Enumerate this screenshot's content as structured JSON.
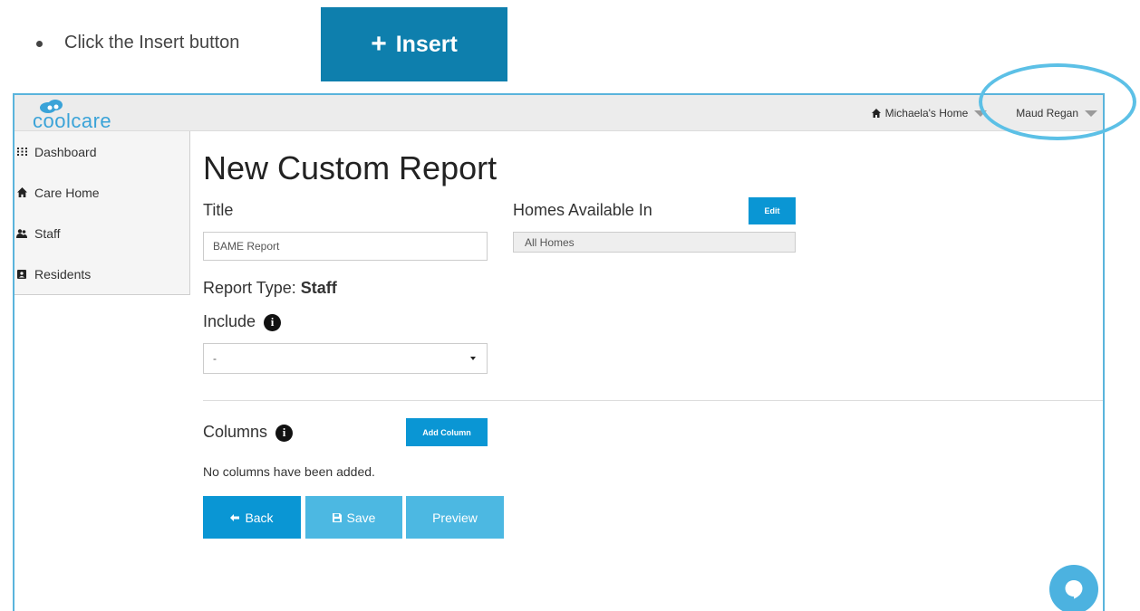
{
  "instruction": {
    "text": "Click the Insert button",
    "sample_button": {
      "icon": "plus-icon",
      "label": "Insert",
      "color": "#0e7fad"
    }
  },
  "app": {
    "logo_text": "coolcare",
    "header": {
      "home_icon": "home-icon",
      "home_label": "Michaela's Home",
      "user_label": "Maud Regan"
    },
    "sidebar": {
      "items": [
        {
          "icon": "grid-icon",
          "label": "Dashboard"
        },
        {
          "icon": "home-icon",
          "label": "Care Home"
        },
        {
          "icon": "users-icon",
          "label": "Staff"
        },
        {
          "icon": "contact-card-icon",
          "label": "Residents"
        }
      ]
    },
    "form": {
      "page_title": "New Custom Report",
      "title_label": "Title",
      "title_value": "BAME Report",
      "homes_label": "Homes Available In",
      "edit_button": "Edit",
      "homes_value": "All Homes",
      "report_type_label": "Report Type:",
      "report_type_value": "Staff",
      "include_label": "Include",
      "include_value": "-",
      "columns_label": "Columns",
      "add_column_button": "Add Column",
      "no_columns_text": "No columns have been added.",
      "back_button": "Back",
      "save_button": "Save",
      "preview_button": "Preview"
    }
  },
  "colors": {
    "primary": "#0a96d4",
    "primary_light": "#4cb8e2",
    "frame": "#5ab4dc",
    "highlight": "#5cc0e6"
  }
}
